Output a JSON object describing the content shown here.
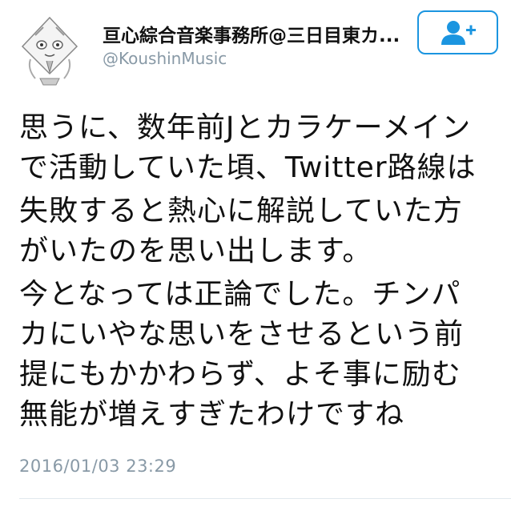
{
  "user": {
    "display_name": "亘心綜合音楽事務所@三日目東カ...",
    "handle": "@KoushinMusic"
  },
  "follow_button": {
    "icon": "add-user-icon"
  },
  "tweet": {
    "paragraphs": [
      [
        "思うに、数年前Jとカラケーメイン",
        "で活動していた頃、Twitter路線は"
      ],
      [
        "失敗すると熱心に解説していた方",
        "がいたのを思い出します。"
      ],
      [
        "今となっては正論でした。チンパ",
        "カにいやな思いをさせるという前",
        "提にもかかわらず、よそ事に励む",
        "無能が増えすぎたわけですね"
      ]
    ],
    "timestamp": "2016/01/03 23:29"
  },
  "colors": {
    "accent": "#1b95e0",
    "muted_text": "#8899a6",
    "divider": "#e1e8ed"
  }
}
